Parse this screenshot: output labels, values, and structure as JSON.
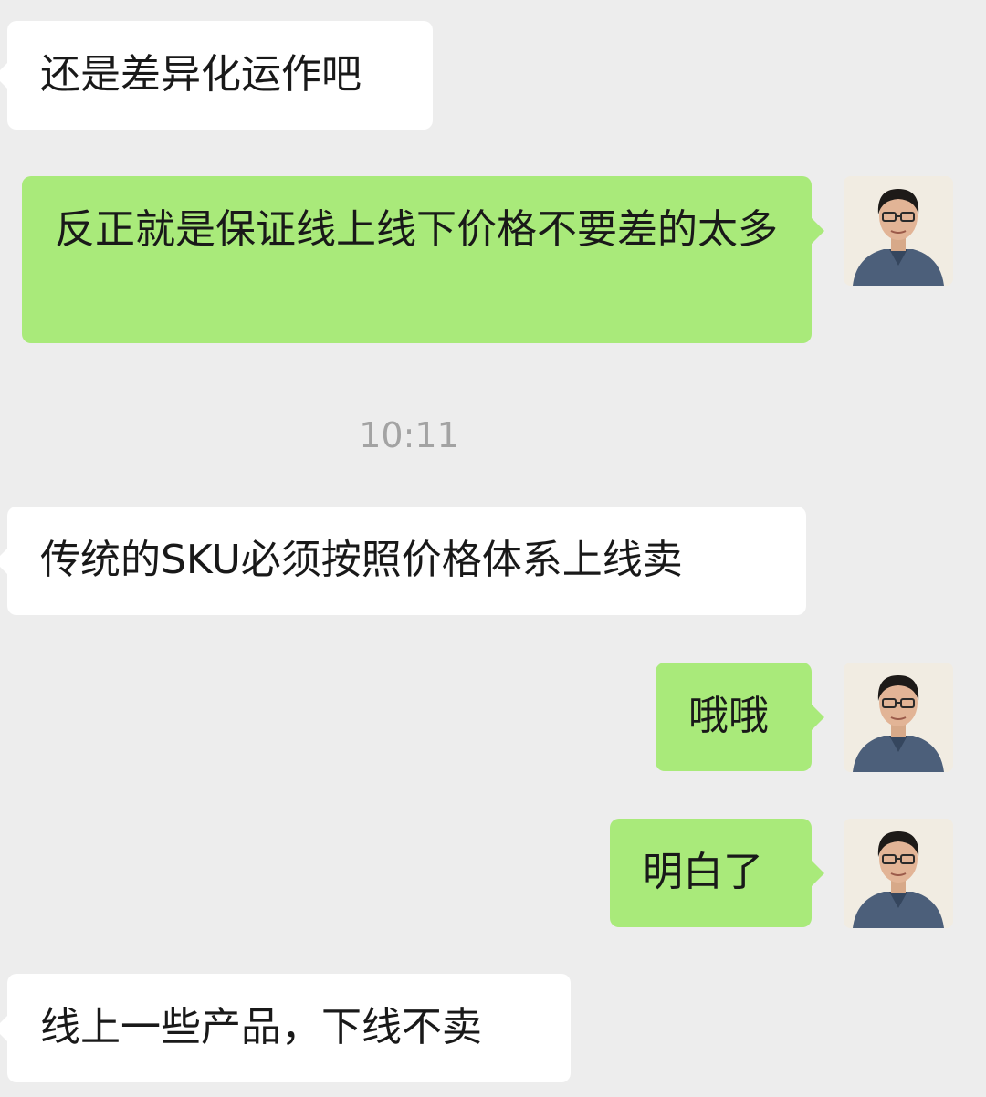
{
  "colors": {
    "background": "#ededed",
    "incoming_bubble": "#ffffff",
    "outgoing_bubble": "#a9ea7a",
    "timestamp_text": "#a3a3a3"
  },
  "messages": [
    {
      "direction": "incoming",
      "text": "还是差异化运作吧"
    },
    {
      "direction": "outgoing",
      "text": "反正就是保证线上线下价格不要差的太多",
      "avatar": "user-avatar"
    },
    {
      "direction": "incoming",
      "text": "传统的SKU必须按照价格体系上线卖"
    },
    {
      "direction": "outgoing",
      "text": "哦哦",
      "avatar": "user-avatar"
    },
    {
      "direction": "outgoing",
      "text": "明白了",
      "avatar": "user-avatar"
    },
    {
      "direction": "incoming",
      "text": "线上一些产品，下线不卖"
    }
  ],
  "timestamp": "10:11"
}
